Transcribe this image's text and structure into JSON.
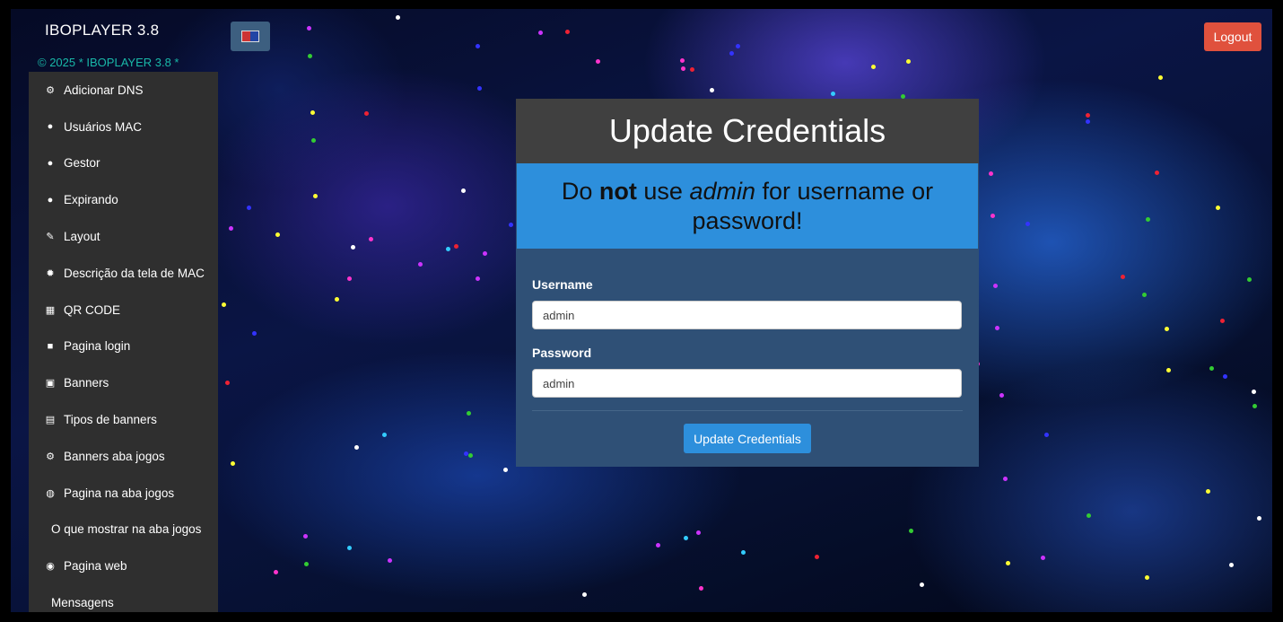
{
  "header": {
    "brand": "IBOPLAYER 3.8",
    "copyright": "© 2025 * IBOPLAYER 3.8 *",
    "logout_label": "Logout"
  },
  "sidebar": {
    "items": [
      {
        "label": "Adicionar DNS",
        "icon": "cogs-icon"
      },
      {
        "label": "Usuários MAC",
        "icon": "user-icon"
      },
      {
        "label": "Gestor",
        "icon": "user-icon"
      },
      {
        "label": "Expirando",
        "icon": "user-icon"
      },
      {
        "label": "Layout",
        "icon": "brush-icon"
      },
      {
        "label": "Descrição da tela de MAC",
        "icon": "gear-icon"
      },
      {
        "label": "QR CODE",
        "icon": "qrcode-icon"
      },
      {
        "label": "Pagina login",
        "icon": "lock-icon"
      },
      {
        "label": "Banners",
        "icon": "image-icon"
      },
      {
        "label": "Tipos de banners",
        "icon": "list-icon"
      },
      {
        "label": "Banners aba jogos",
        "icon": "cogs-icon"
      },
      {
        "label": "Pagina na aba jogos",
        "icon": "gamepad-icon"
      },
      {
        "label": "O que mostrar na aba jogos",
        "icon": ""
      },
      {
        "label": "Pagina web",
        "icon": "globe-icon"
      },
      {
        "label": "Mensagens",
        "icon": ""
      }
    ]
  },
  "card": {
    "title": "Update Credentials",
    "alert": {
      "part1": "Do ",
      "bold": "not",
      "part2": " use ",
      "italic": "admin",
      "part3": " for username or password!"
    },
    "username_label": "Username",
    "username_value": "admin",
    "password_label": "Password",
    "password_value": "admin",
    "submit_label": "Update Credentials"
  },
  "colors": {
    "accent": "#2d8fdc",
    "logout": "#e0513d",
    "card": "#2f5076",
    "sidebar": "#2f2f2f",
    "copyright": "#19b8a8"
  }
}
